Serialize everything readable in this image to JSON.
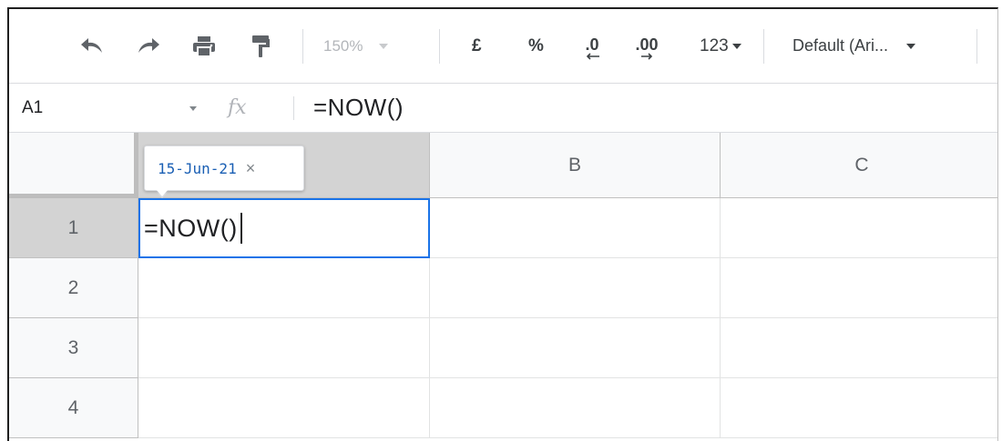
{
  "toolbar": {
    "undo_icon": "undo-icon",
    "redo_icon": "redo-icon",
    "print_icon": "print-icon",
    "paint_format_icon": "paint-format-icon",
    "zoom": "150%",
    "currency": "£",
    "percent": "%",
    "decrease_decimal": ".0",
    "increase_decimal": ".00",
    "more_formats": "123",
    "font": "Default (Ari..."
  },
  "formula_bar": {
    "name_box": "A1",
    "fx_label": "fx",
    "formula": "=NOW()"
  },
  "grid": {
    "columns": [
      "",
      "B",
      "C"
    ],
    "rows": [
      "1",
      "2",
      "3",
      "4"
    ],
    "active_cell": {
      "ref": "A1",
      "edit_text": "=NOW()"
    },
    "tooltip": {
      "text": "15-Jun-21",
      "close": "×"
    }
  },
  "colors": {
    "selection": "#1a73e8",
    "header_bg": "#f8f9fa",
    "selected_header_bg": "#d3d3d3",
    "tooltip_text": "#1a5fb4"
  }
}
